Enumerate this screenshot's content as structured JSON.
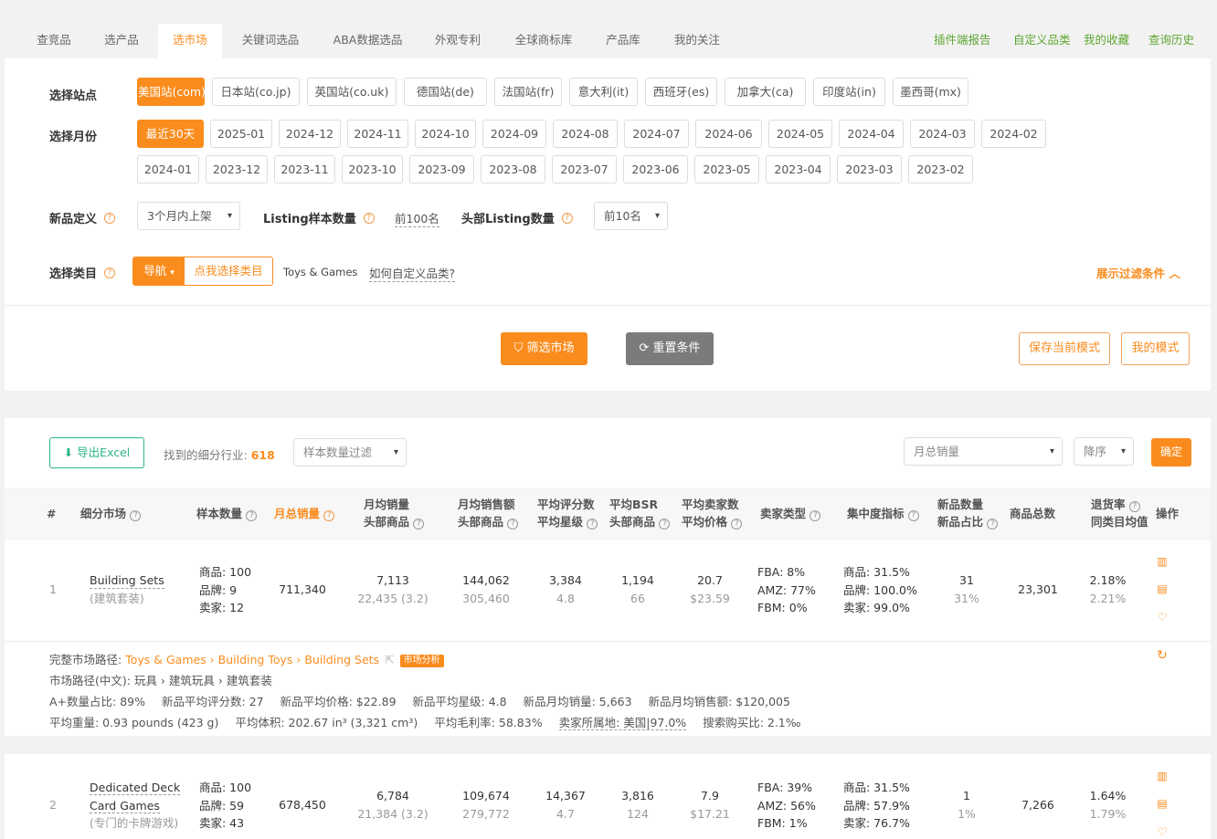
{
  "tabs": [
    "查竞品",
    "选产品",
    "选市场",
    "关键词选品",
    "ABA数据选品",
    "外观专利",
    "全球商标库",
    "产品库",
    "我的关注"
  ],
  "right_links": [
    "插件端报告",
    "自定义品类",
    "我的收藏",
    "查询历史"
  ],
  "filter": {
    "site_label": "选择站点",
    "sites": [
      "美国站(com)",
      "日本站(co.jp)",
      "英国站(co.uk)",
      "德国站(de)",
      "法国站(fr)",
      "意大利(it)",
      "西班牙(es)",
      "加拿大(ca)",
      "印度站(in)",
      "墨西哥(mx)"
    ],
    "month_label": "选择月份",
    "months1": [
      "最近30天",
      "2025-01",
      "2024-12",
      "2024-11",
      "2024-10",
      "2024-09",
      "2024-08",
      "2024-07",
      "2024-06",
      "2024-05",
      "2024-04",
      "2024-03",
      "2024-02"
    ],
    "months2": [
      "2024-01",
      "2023-12",
      "2023-11",
      "2023-10",
      "2023-09",
      "2023-08",
      "2023-07",
      "2023-06",
      "2023-05",
      "2023-04",
      "2023-03",
      "2023-02"
    ],
    "newdef_label": "新品定义",
    "newdef_value": "3个月内上架",
    "listing_label": "Listing样本数量",
    "listing_value": "前100名",
    "head_label": "头部Listing数量",
    "head_value": "前10名",
    "cat_label": "选择类目",
    "nav_btn": "导航",
    "pick_btn": "点我选择类目",
    "cat_value": "Toys & Games",
    "howto": "如何自定义品类?",
    "show_filter": "展示过滤条件",
    "filter_btn": "筛选市场",
    "reset_btn": "重置条件",
    "save_btn": "保存当前模式",
    "mymode_btn": "我的模式"
  },
  "toolbar": {
    "export": "导出Excel",
    "found_label": "找到的细分行业:",
    "found_count": "618",
    "sample_filter": "样本数量过滤",
    "sort_field": "月总销量",
    "sort_order": "降序",
    "confirm": "确定"
  },
  "headers": {
    "num": "#",
    "market": "细分市场",
    "sample": "样本数量",
    "total": "月总销量",
    "avg_sales": [
      "月均销量",
      "头部商品"
    ],
    "avg_rev": [
      "月均销售额",
      "头部商品"
    ],
    "rating": [
      "平均评分数",
      "平均星级"
    ],
    "bsr": [
      "平均BSR",
      "头部商品"
    ],
    "sellers": [
      "平均卖家数",
      "平均价格"
    ],
    "seller_type": "卖家类型",
    "conc": "集中度指标",
    "newp": [
      "新品数量",
      "新品占比"
    ],
    "total_goods": "商品总数",
    "returns": [
      "退货率",
      "同类目均值"
    ],
    "ops": "操作"
  },
  "rows": [
    {
      "num": "1",
      "name": "Building Sets",
      "cn": "(建筑套装)",
      "sample": [
        "商品: 100",
        "品牌: 9",
        "卖家: 12"
      ],
      "total": "711,340",
      "avg_sales": "7,113",
      "avg_sales_sub": "22,435 (3.2)",
      "avg_rev": "144,062",
      "avg_rev_sub": "305,460",
      "rating": "3,384",
      "rating_sub": "4.8",
      "bsr": "1,194",
      "bsr_sub": "66",
      "sellers": "20.7",
      "price": "$23.59",
      "stype": [
        "FBA: 8%",
        "AMZ: 77%",
        "FBM: 0%"
      ],
      "conc": [
        "商品: 31.5%",
        "品牌: 100.0%",
        "卖家: 99.0%"
      ],
      "newp": "31",
      "newp_sub": "31%",
      "goods": "23,301",
      "ret": "2.18%",
      "ret_sub": "2.21%"
    },
    {
      "num": "2",
      "name1": "Dedicated Deck",
      "name2": "Card Games",
      "cn": "(专门的卡牌游戏)",
      "sample": [
        "商品: 100",
        "品牌: 59",
        "卖家: 43"
      ],
      "total": "678,450",
      "avg_sales": "6,784",
      "avg_sales_sub": "21,384 (3.2)",
      "avg_rev": "109,674",
      "avg_rev_sub": "279,772",
      "rating": "14,367",
      "rating_sub": "4.7",
      "bsr": "3,816",
      "bsr_sub": "124",
      "sellers": "7.9",
      "price": "$17.21",
      "stype": [
        "FBA: 39%",
        "AMZ: 56%",
        "FBM: 1%"
      ],
      "conc": [
        "商品: 31.5%",
        "品牌: 57.9%",
        "卖家: 76.7%"
      ],
      "newp": "1",
      "newp_sub": "1%",
      "goods": "7,266",
      "ret": "1.64%",
      "ret_sub": "1.79%"
    }
  ],
  "detail": {
    "path_label": "完整市场路径:",
    "path": "Toys & Games › Building Toys › Building Sets",
    "analysis": "市场分析",
    "cnpath": "市场路径(中文): 玩具 › 建筑玩具 › 建筑套装",
    "line3": [
      "A+数量占比: 89%",
      "新品平均评分数: 27",
      "新品平均价格: $22.89",
      "新品平均星级: 4.8",
      "新品月均销量: 5,663",
      "新品月均销售额: $120,005"
    ],
    "line4": [
      "平均重量: 0.93 pounds (423 g)",
      "平均体积: 202.67 in³ (3,321 cm³)",
      "平均毛利率: 58.83%",
      "卖家所属地: 美国|97.0%",
      "搜索购买比: 2.1‰"
    ]
  }
}
